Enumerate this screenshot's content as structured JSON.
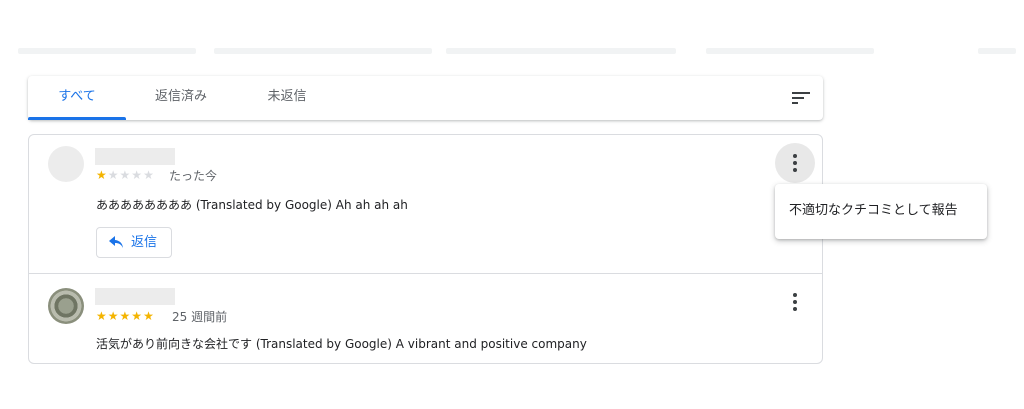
{
  "tabs": {
    "items": [
      {
        "label": "すべて",
        "active": true
      },
      {
        "label": "返信済み",
        "active": false
      },
      {
        "label": "未返信",
        "active": false
      }
    ],
    "sort_icon": "sort-icon",
    "accent": "#1a73e8"
  },
  "reviews": [
    {
      "rating": 1,
      "max_rating": 5,
      "time": "たった今",
      "text": "ああああああああ (Translated by Google) Ah ah ah ah",
      "reply_label": "返信",
      "reply_icon": "reply-icon",
      "more_icon": "more-vert-icon"
    },
    {
      "rating": 5,
      "max_rating": 5,
      "time": "25 週間前",
      "text": "活気があり前向きな会社です (Translated by Google) A vibrant and positive company",
      "more_icon": "more-vert-icon"
    }
  ],
  "menu": {
    "report_label": "不適切なクチコミとして報告"
  },
  "colors": {
    "star_filled": "#f4b400",
    "star_empty": "#dadce0"
  }
}
